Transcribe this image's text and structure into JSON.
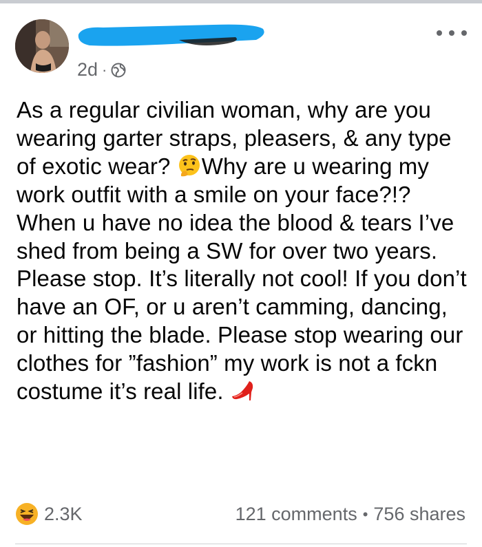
{
  "post": {
    "time": "2d",
    "separator": "·",
    "text_parts": [
      "As a regular civilian woman, why are you wearing garter straps, pleasers, & any type of exotic wear? ",
      "Why are u wearing my work outfit with a smile on your face?!? When u have no idea the blood & tears I’ve shed from being a SW for over two years. Please stop. It’s literally not cool! If you don’t have an OF, or u aren’t camming, dancing, or hitting the blade. Please stop wearing our clothes for ”fashion” my work is not a fckn costume it’s real life. "
    ],
    "emojis": [
      "thinking-face-icon",
      "high-heel-icon"
    ]
  },
  "footer": {
    "reaction_icon": "laughing-face-icon",
    "reaction_count": "2.3K",
    "comments": "121 comments",
    "dot": "•",
    "shares": "756 shares"
  },
  "colors": {
    "redaction": "#1aa3ef",
    "meta_gray": "#65676b",
    "text": "#050505",
    "divider": "#ced0d4"
  }
}
